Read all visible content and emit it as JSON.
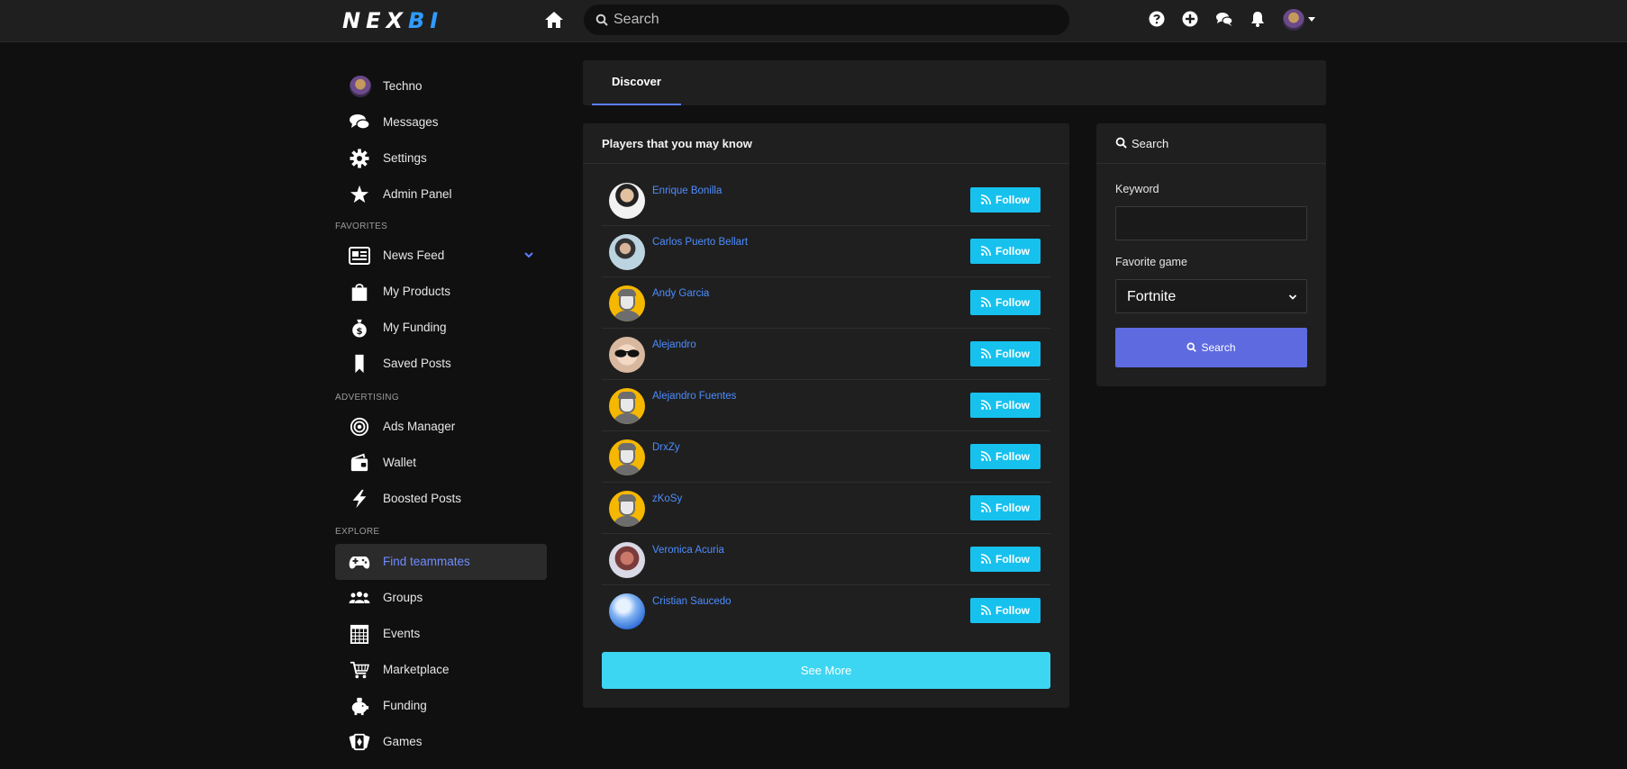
{
  "brand": {
    "logo_part1": "NEX",
    "logo_part2": "BI"
  },
  "topbar": {
    "search_placeholder": "Search",
    "icons": [
      "home-icon",
      "help-icon",
      "add-icon",
      "chat-icon",
      "bell-icon",
      "avatar"
    ]
  },
  "sidebar": {
    "profile_label": "Techno",
    "main_items": [
      {
        "label": "Messages",
        "icon": "messages-icon"
      },
      {
        "label": "Settings",
        "icon": "gear-icon"
      },
      {
        "label": "Admin Panel",
        "icon": "star-icon"
      }
    ],
    "favorites_heading": "FAVORITES",
    "favorites": [
      {
        "label": "News Feed",
        "icon": "newspaper-icon"
      },
      {
        "label": "My Products",
        "icon": "shopping-bag-icon"
      },
      {
        "label": "My Funding",
        "icon": "money-bag-icon"
      },
      {
        "label": "Saved Posts",
        "icon": "bookmark-icon"
      }
    ],
    "advertising_heading": "ADVERTISING",
    "advertising": [
      {
        "label": "Ads Manager",
        "icon": "target-icon"
      },
      {
        "label": "Wallet",
        "icon": "wallet-icon"
      },
      {
        "label": "Boosted Posts",
        "icon": "bolt-icon"
      }
    ],
    "explore_heading": "EXPLORE",
    "explore": [
      {
        "label": "Find teammates",
        "icon": "gamepad-icon",
        "active": true
      },
      {
        "label": "Groups",
        "icon": "groups-icon"
      },
      {
        "label": "Events",
        "icon": "calendar-icon"
      },
      {
        "label": "Marketplace",
        "icon": "cart-icon"
      },
      {
        "label": "Funding",
        "icon": "piggy-bank-icon"
      },
      {
        "label": "Games",
        "icon": "cards-icon"
      }
    ]
  },
  "tabs": {
    "discover": "Discover"
  },
  "players": {
    "title": "Players that you may know",
    "follow_label": "Follow",
    "see_more": "See More",
    "list": [
      {
        "name": "Enrique Bonilla"
      },
      {
        "name": "Carlos Puerto Bellart"
      },
      {
        "name": "Andy Garcia"
      },
      {
        "name": "Alejandro"
      },
      {
        "name": "Alejandro Fuentes"
      },
      {
        "name": "DrxZy"
      },
      {
        "name": "zKoSy"
      },
      {
        "name": "Veronica Acuria"
      },
      {
        "name": "Cristian Saucedo"
      }
    ]
  },
  "search_panel": {
    "title": "Search",
    "keyword_label": "Keyword",
    "keyword_value": "",
    "game_label": "Favorite game",
    "game_value": "Fortnite",
    "button_label": "Search"
  },
  "colors": {
    "background": "#101010",
    "panel": "#1f1f1f",
    "follow": "#17c1ee",
    "see_more": "#3dd6f2",
    "search_button": "#5e6be0",
    "link": "#4d8dff",
    "active": "#6f8cff"
  }
}
